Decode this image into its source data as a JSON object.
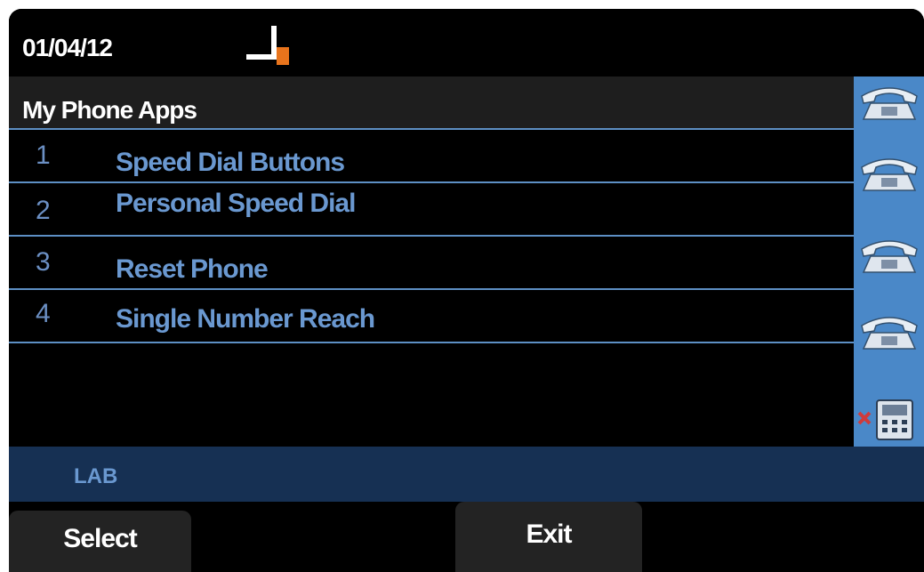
{
  "status": {
    "date": "01/04/12",
    "line_icon": "line-status-icon",
    "line_icon_accent": "#e8741c"
  },
  "header": {
    "title": "My Phone Apps"
  },
  "menu": {
    "items": [
      {
        "number": "1",
        "label": "Speed Dial Buttons"
      },
      {
        "number": "2",
        "label": "Personal Speed Dial"
      },
      {
        "number": "3",
        "label": "Reset Phone"
      },
      {
        "number": "4",
        "label": "Single Number Reach"
      }
    ]
  },
  "side_panel": {
    "line_buttons": [
      "phone-icon",
      "phone-icon",
      "phone-icon",
      "phone-icon"
    ],
    "bottom_icon": "handset-disabled-icon"
  },
  "footer": {
    "label": "LAB"
  },
  "softkeys": {
    "select": "Select",
    "exit": "Exit"
  },
  "colors": {
    "accent_blue": "#5d8fc4",
    "menu_text": "#6a98d0",
    "footer_bg": "#163053",
    "side_panel_bg": "#4a88c8"
  }
}
